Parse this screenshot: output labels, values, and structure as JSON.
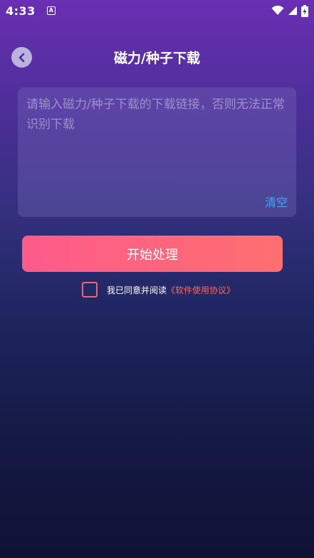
{
  "status": {
    "time": "4:33",
    "notification_icon": "android-a-icon",
    "icons": [
      "wifi-icon",
      "signal-icon",
      "battery-charging-icon"
    ]
  },
  "header": {
    "title": "磁力/种子下载",
    "back_icon": "back-arrow-icon"
  },
  "input": {
    "placeholder": "请输入磁力/种子下载的下载链接，否则无法正常识别下载",
    "value": "",
    "clear_label": "清空"
  },
  "actions": {
    "start_label": "开始处理"
  },
  "agreement": {
    "checked": false,
    "text": "我已同意并阅读",
    "link": "《软件使用协议》"
  },
  "colors": {
    "accent_start": "#fd5b8b",
    "accent_end": "#fe6f70",
    "link": "#f36a6a",
    "clear": "#49a5f5"
  }
}
